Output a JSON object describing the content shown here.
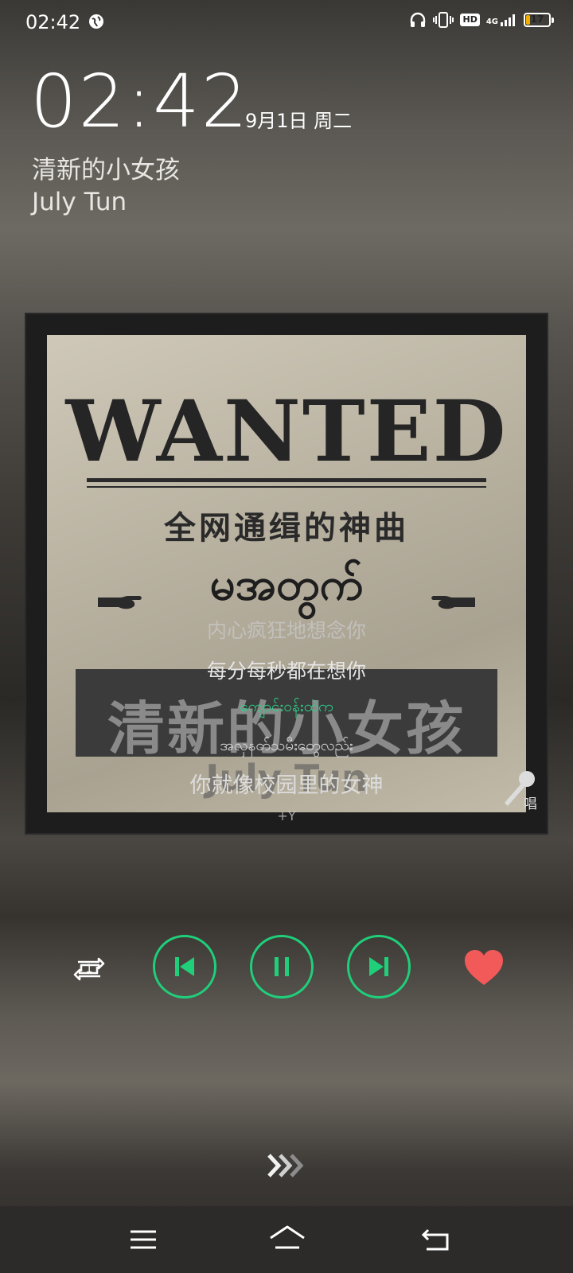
{
  "status_bar": {
    "time": "02:42",
    "network": "4G",
    "hd": "HD",
    "battery": "17",
    "battery_level": 0.17,
    "icons": [
      "globe-icon",
      "headphones-icon",
      "vibrate-icon",
      "hd-icon",
      "signal-icon",
      "battery-icon"
    ]
  },
  "lockscreen": {
    "clock": "02:42",
    "date": "9月1日 周二"
  },
  "now_playing": {
    "title": "清新的小女孩",
    "artist": "July Tun"
  },
  "album_cover": {
    "headline": "WANTED",
    "subtitle": "全网通缉的神曲",
    "burmese_title": "မအတွက်",
    "band_title": "清新的小女孩",
    "artist": "July Tun"
  },
  "lyrics": [
    "内心疯狂地想念你",
    "每分每秒都在想你",
    "ကျောင်းဝန်းထဲက",
    "အလှနတ်သမီးတွေလည်း",
    "你就像校园里的女神",
    "+Y"
  ],
  "karaoke": {
    "label": "唱"
  },
  "controls": {
    "repeat_mode": "1",
    "items": [
      "repeat-one-button",
      "previous-button",
      "pause-button",
      "next-button",
      "favorite-button"
    ],
    "accent_color": "#1fcf7a",
    "favorite_color": "#f25a5a"
  },
  "navigation": {
    "items": [
      "menu-button",
      "home-button",
      "back-button"
    ]
  }
}
